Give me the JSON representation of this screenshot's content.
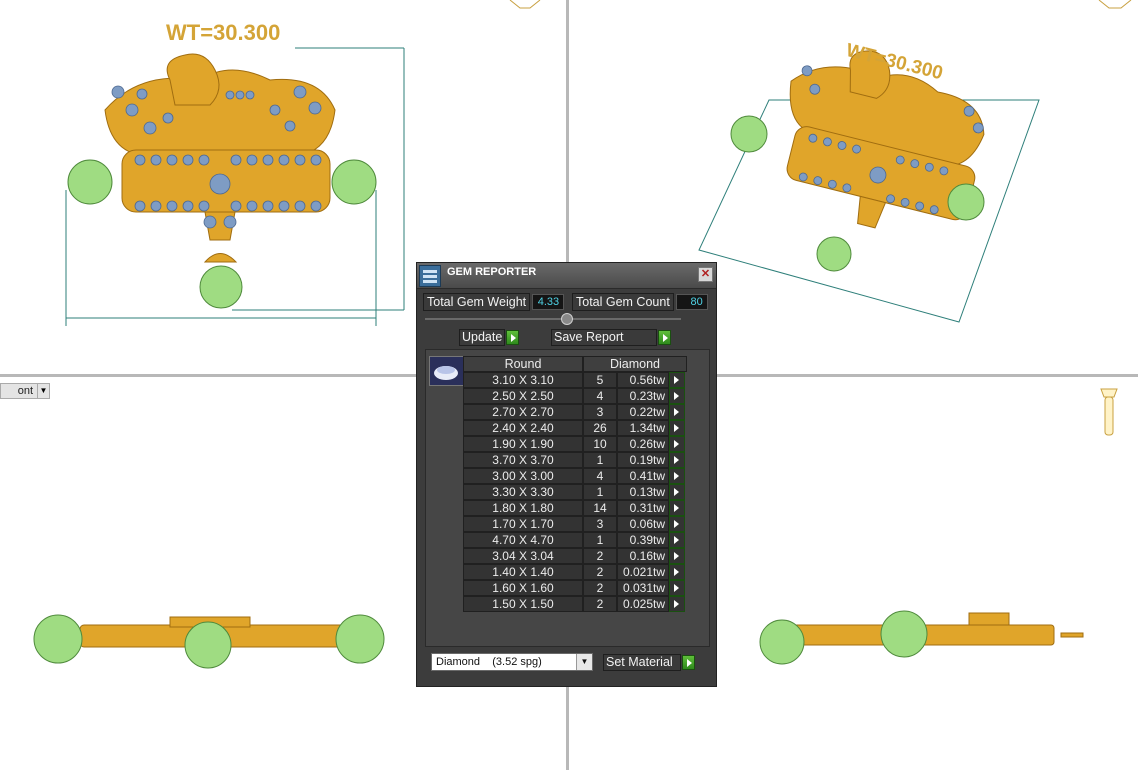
{
  "viewports": {
    "top_left": {
      "weight_label": "WT=30.300"
    },
    "top_right": {
      "weight_label": "WT=30.300"
    },
    "bottom_left": {
      "view_dropdown": "ont"
    }
  },
  "colors": {
    "gold": "#e0a52a",
    "gem_blue": "#7e9cc4",
    "pearl_green": "#9fdc82",
    "dimension_line": "#2e7f7a",
    "go_button": "#3fa02a",
    "value_text": "#4fd3e6"
  },
  "panel": {
    "title": "GEM REPORTER",
    "total_gem_weight_label": "Total Gem Weight",
    "total_gem_weight": "4.33",
    "total_gem_count_label": "Total Gem Count",
    "total_gem_count": "80",
    "update_label": "Update",
    "save_report_label": "Save Report",
    "table": {
      "shape_header": "Round",
      "material_header": "Diamond",
      "rows": [
        {
          "size": "3.10 X 3.10",
          "count": "5",
          "weight": "0.56tw"
        },
        {
          "size": "2.50 X 2.50",
          "count": "4",
          "weight": "0.23tw"
        },
        {
          "size": "2.70 X 2.70",
          "count": "3",
          "weight": "0.22tw"
        },
        {
          "size": "2.40 X 2.40",
          "count": "26",
          "weight": "1.34tw"
        },
        {
          "size": "1.90 X 1.90",
          "count": "10",
          "weight": "0.26tw"
        },
        {
          "size": "3.70 X 3.70",
          "count": "1",
          "weight": "0.19tw"
        },
        {
          "size": "3.00 X 3.00",
          "count": "4",
          "weight": "0.41tw"
        },
        {
          "size": "3.30 X 3.30",
          "count": "1",
          "weight": "0.13tw"
        },
        {
          "size": "1.80 X 1.80",
          "count": "14",
          "weight": "0.31tw"
        },
        {
          "size": "1.70 X 1.70",
          "count": "3",
          "weight": "0.06tw"
        },
        {
          "size": "4.70 X 4.70",
          "count": "1",
          "weight": "0.39tw"
        },
        {
          "size": "3.04 X 3.04",
          "count": "2",
          "weight": "0.16tw"
        },
        {
          "size": "1.40 X 1.40",
          "count": "2",
          "weight": "0.021tw"
        },
        {
          "size": "1.60 X 1.60",
          "count": "2",
          "weight": "0.031tw"
        },
        {
          "size": "1.50 X 1.50",
          "count": "2",
          "weight": "0.025tw"
        }
      ]
    },
    "material_select": "Diamond    (3.52 spg)",
    "set_material_label": "Set Material"
  },
  "icons": {
    "app": "gem-reporter-icon",
    "close": "close-icon",
    "gem_preview": "round-gem-icon",
    "go": "green-arrow-icon",
    "view_cube": "view-cube-icon",
    "camera": "camera-icon"
  }
}
